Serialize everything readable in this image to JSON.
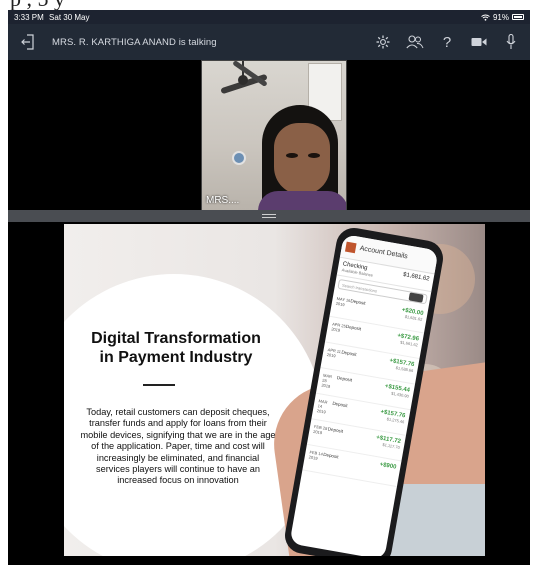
{
  "top_scrawl": "p              , 5              y",
  "statusbar": {
    "time": "3:33 PM",
    "date": "Sat 30 May",
    "battery": "91%"
  },
  "meeting": {
    "talking": "MRS. R. KARTHIGA ANAND is talking",
    "icons": [
      "leave-icon",
      "settings-icon",
      "participants-icon",
      "help-icon",
      "camera-icon",
      "microphone-icon"
    ],
    "help_glyph": "?"
  },
  "video": {
    "participant_name": "MRS...."
  },
  "slide": {
    "title_line1": "Digital Transformation",
    "title_line2": "in Payment Industry",
    "body": "Today, retail customers can deposit cheques, transfer funds and apply for loans from their mobile devices, signifying that we are in the age of the application. Paper, time and cost will increasingly be eliminated, and financial services players will continue to have an increased focus on innovation"
  },
  "phone": {
    "header": "Account Details",
    "account_name": "Checking",
    "account_sub": "Available Balance",
    "account_balance": "$1,681.62",
    "search_placeholder": "Search transactions",
    "transactions": [
      {
        "date": "MAY 16 2019",
        "type": "Deposit",
        "amount": "+$20.00",
        "balance": "$1,681.62"
      },
      {
        "date": "APR 25 2019",
        "type": "Deposit",
        "amount": "+$72.96",
        "balance": "$1,661.62"
      },
      {
        "date": "APR 11 2019",
        "type": "Deposit",
        "amount": "+$157.76",
        "balance": "$1,588.66"
      },
      {
        "date": "MAR 28 2019",
        "type": "Deposit",
        "amount": "+$155.44",
        "balance": "$1,430.90"
      },
      {
        "date": "MAR 14 2019",
        "type": "Deposit",
        "amount": "+$157.76",
        "balance": "$1,275.46"
      },
      {
        "date": "FEB 28 2019",
        "type": "Deposit",
        "amount": "+$117.72",
        "balance": "$1,117.70"
      },
      {
        "date": "FEB 14 2019",
        "type": "Deposit",
        "amount": "+$900",
        "balance": ""
      }
    ]
  },
  "colors": {
    "meeting_bar": "#222a36",
    "status_bar": "#1d2330",
    "splitter": "#4a4d52",
    "deposit_green": "#3a9a43"
  }
}
